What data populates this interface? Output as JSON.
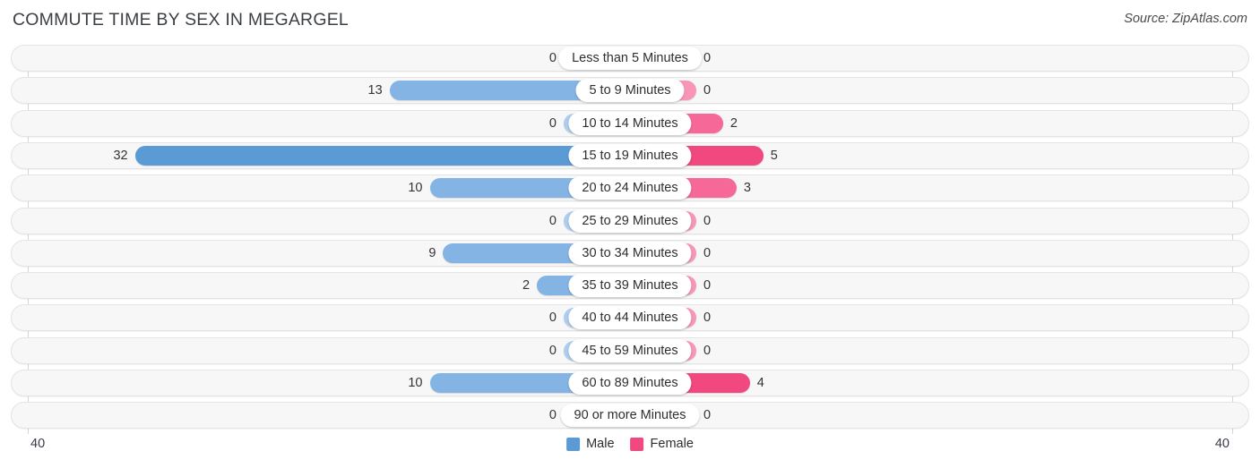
{
  "header": {
    "title": "COMMUTE TIME BY SEX IN MEGARGEL",
    "source": "Source: ZipAtlas.com"
  },
  "axis": {
    "left_tick": "40",
    "right_tick": "40",
    "max": 40
  },
  "legend": [
    {
      "label": "Male",
      "color": "#5b9bd5"
    },
    {
      "label": "Female",
      "color": "#f0487f"
    }
  ],
  "colors": {
    "male_strong": "#5b9bd5",
    "male_mid": "#84b4e3",
    "male_light": "#aecdee",
    "female_strong": "#f0487f",
    "female_mid": "#f56897",
    "female_light": "#f896b8",
    "track": "#f7f7f7",
    "track_border": "#e4e4e4",
    "axis": "#d6d6d6"
  },
  "chart_data": {
    "type": "bar",
    "title": "COMMUTE TIME BY SEX IN MEGARGEL",
    "orientation": "horizontal-diverging",
    "xlabel": "",
    "ylabel": "",
    "xlim": [
      40,
      40
    ],
    "grid": false,
    "legend_position": "bottom-center",
    "categories": [
      "Less than 5 Minutes",
      "5 to 9 Minutes",
      "10 to 14 Minutes",
      "15 to 19 Minutes",
      "20 to 24 Minutes",
      "25 to 29 Minutes",
      "30 to 34 Minutes",
      "35 to 39 Minutes",
      "40 to 44 Minutes",
      "45 to 59 Minutes",
      "60 to 89 Minutes",
      "90 or more Minutes"
    ],
    "series": [
      {
        "name": "Male",
        "values": [
          0,
          13,
          0,
          32,
          10,
          0,
          9,
          2,
          0,
          0,
          10,
          0
        ]
      },
      {
        "name": "Female",
        "values": [
          0,
          0,
          2,
          5,
          3,
          0,
          0,
          0,
          0,
          0,
          4,
          0
        ]
      }
    ]
  },
  "rows": [
    {
      "label": "Less than 5 Minutes",
      "male": "0",
      "female": "0",
      "male_val": 0,
      "female_val": 0
    },
    {
      "label": "5 to 9 Minutes",
      "male": "13",
      "female": "0",
      "male_val": 13,
      "female_val": 0
    },
    {
      "label": "10 to 14 Minutes",
      "male": "0",
      "female": "2",
      "male_val": 0,
      "female_val": 2
    },
    {
      "label": "15 to 19 Minutes",
      "male": "32",
      "female": "5",
      "male_val": 32,
      "female_val": 5
    },
    {
      "label": "20 to 24 Minutes",
      "male": "10",
      "female": "3",
      "male_val": 10,
      "female_val": 3
    },
    {
      "label": "25 to 29 Minutes",
      "male": "0",
      "female": "0",
      "male_val": 0,
      "female_val": 0
    },
    {
      "label": "30 to 34 Minutes",
      "male": "9",
      "female": "0",
      "male_val": 9,
      "female_val": 0
    },
    {
      "label": "35 to 39 Minutes",
      "male": "2",
      "female": "0",
      "male_val": 2,
      "female_val": 0
    },
    {
      "label": "40 to 44 Minutes",
      "male": "0",
      "female": "0",
      "male_val": 0,
      "female_val": 0
    },
    {
      "label": "45 to 59 Minutes",
      "male": "0",
      "female": "0",
      "male_val": 0,
      "female_val": 0
    },
    {
      "label": "60 to 89 Minutes",
      "male": "10",
      "female": "4",
      "male_val": 10,
      "female_val": 4
    },
    {
      "label": "90 or more Minutes",
      "male": "0",
      "female": "0",
      "male_val": 0,
      "female_val": 0
    }
  ]
}
